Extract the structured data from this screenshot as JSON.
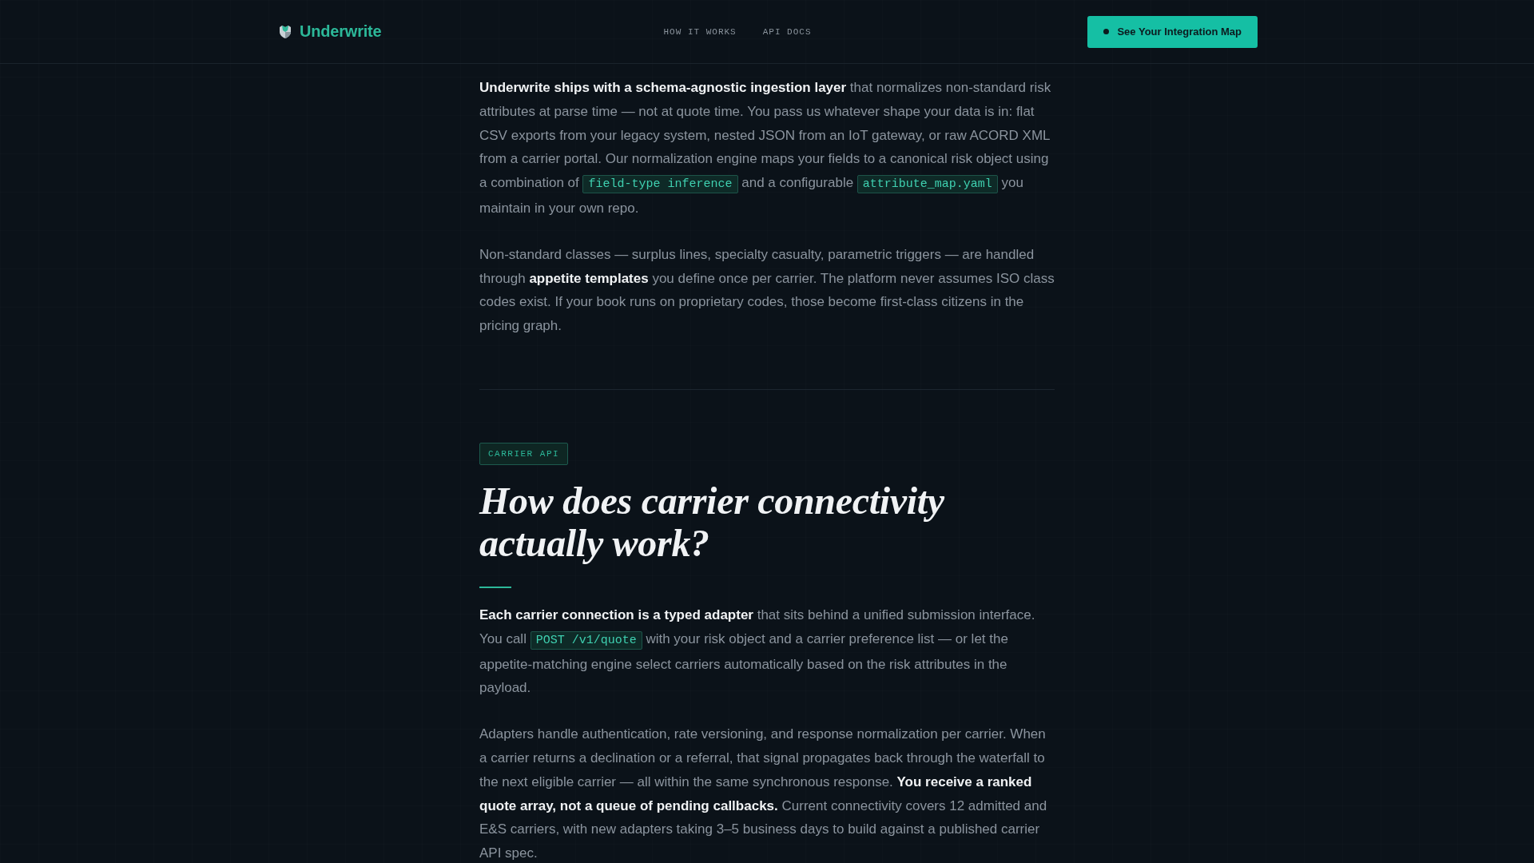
{
  "header": {
    "brand": "Underwrite",
    "nav": [
      "HOW IT WORKS",
      "API DOCS"
    ],
    "cta": "See Your Integration Map"
  },
  "sections": [
    {
      "paragraphs": [
        [
          {
            "kind": "text",
            "text": "**Underwrite ships with a schema-agnostic ingestion layer** that normalizes non-standard risk attributes at parse time — not at quote time. You pass us whatever shape your data is in: flat CSV exports from your legacy system, nested JSON from an IoT gateway, or raw ACORD XML from a carrier portal. Our normalization engine maps your fields to a canonical risk object using a combination of "
          },
          {
            "kind": "code",
            "text": "field-type inference"
          },
          {
            "kind": "text",
            "text": " and a configurable "
          },
          {
            "kind": "code",
            "text": "attribute_map.yaml"
          },
          {
            "kind": "text",
            "text": " you maintain in your own repo."
          }
        ],
        [
          {
            "kind": "text",
            "text": "Non-standard classes — surplus lines, specialty casualty, parametric triggers — are handled through **appetite templates** you define once per carrier. The platform never assumes ISO class codes exist. If your book runs on proprietary codes, those become first-class citizens in the pricing graph."
          }
        ]
      ]
    },
    {
      "tag": "CARRIER API",
      "heading": "How does carrier connectivity actually work?",
      "paragraphs": [
        [
          {
            "kind": "text",
            "text": "**Each carrier connection is a typed adapter** that sits behind a unified submission interface. You call "
          },
          {
            "kind": "code",
            "text": "POST /v1/quote"
          },
          {
            "kind": "text",
            "text": " with your risk object and a carrier preference list — or let the appetite-matching engine select carriers automatically based on the risk attributes in the payload."
          }
        ],
        [
          {
            "kind": "text",
            "text": "Adapters handle authentication, rate versioning, and response normalization per carrier. When a carrier returns a declination or a referral, that signal propagates back through the waterfall to the next eligible carrier — all within the same synchronous response. **You receive a ranked quote array, not a queue of pending callbacks.** Current connectivity covers 12 admitted and E&S carriers, with new adapters taking 3–5 business days to build against a published carrier API spec."
          }
        ]
      ]
    }
  ]
}
